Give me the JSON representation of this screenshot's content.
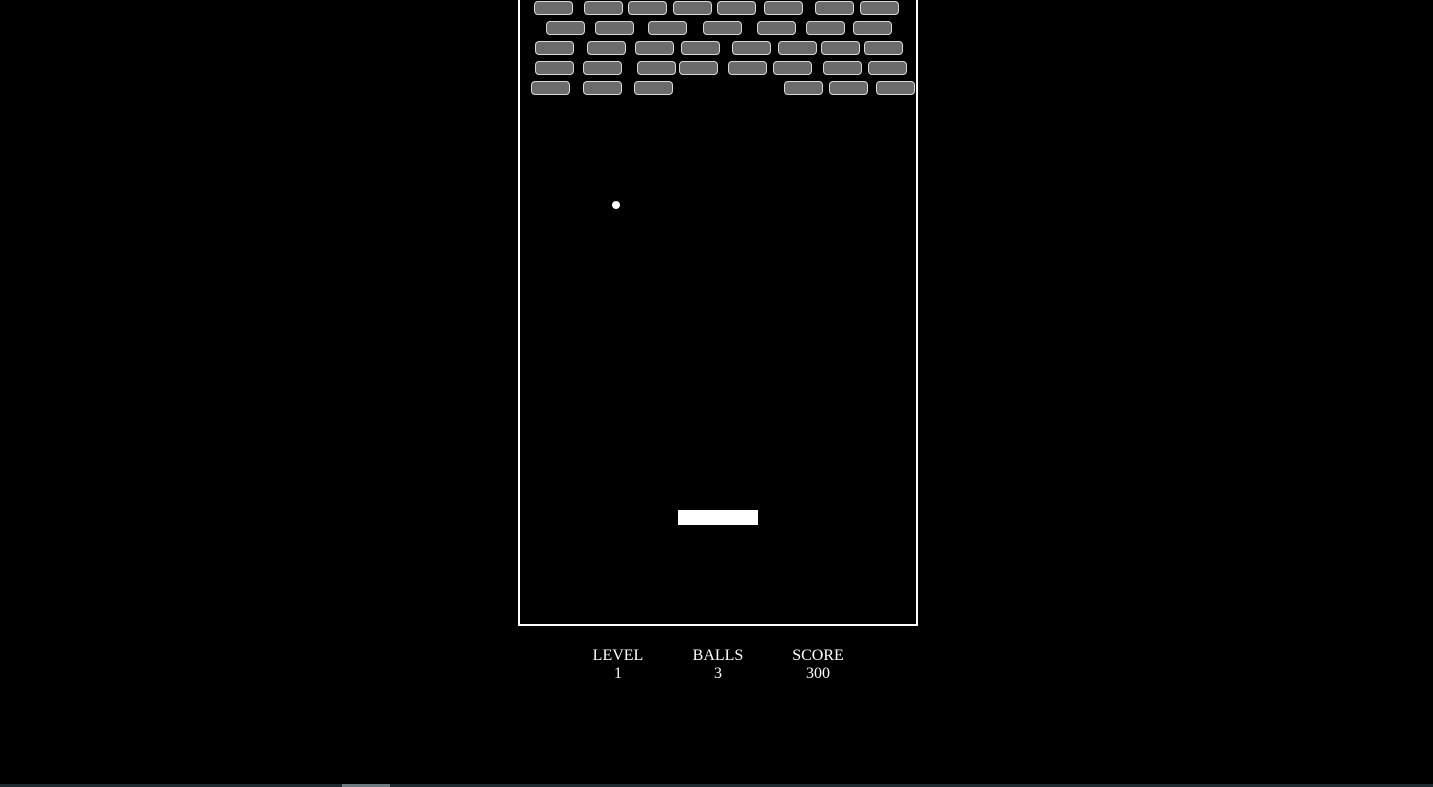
{
  "hud": {
    "level_label": "LEVEL",
    "level_value": "1",
    "balls_label": "BALLS",
    "balls_value": "3",
    "score_label": "SCORE",
    "score_value": "300"
  },
  "game": {
    "bricks_remaining": 37
  },
  "colors": {
    "background": "#000000",
    "border": "#ffffff",
    "brick_fill": "#6b6b6b",
    "brick_outline": "#d8d8d8",
    "ball": "#ffffff",
    "paddle": "#ffffff",
    "text": "#ffffff"
  }
}
